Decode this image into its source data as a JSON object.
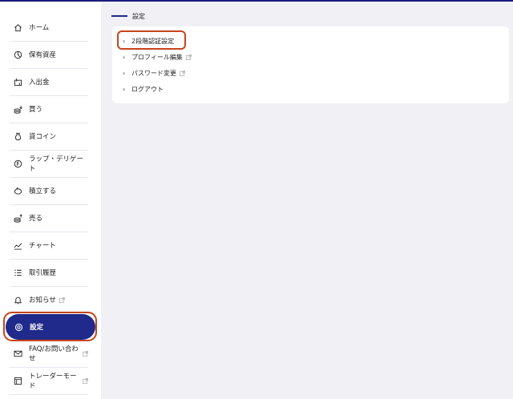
{
  "sidebar": {
    "items": [
      {
        "label": "ホーム",
        "icon": "home-icon"
      },
      {
        "label": "保有資産",
        "icon": "portfolio-icon"
      },
      {
        "label": "入出金",
        "icon": "deposit-withdraw-icon"
      },
      {
        "label": "買う",
        "icon": "buy-icon"
      },
      {
        "label": "貸コイン",
        "icon": "lend-coin-icon"
      },
      {
        "label": "ラップ・デリゲート",
        "icon": "wrap-delegate-icon"
      },
      {
        "label": "積立する",
        "icon": "piggy-bank-icon"
      },
      {
        "label": "売る",
        "icon": "sell-icon"
      },
      {
        "label": "チャート",
        "icon": "chart-icon"
      },
      {
        "label": "取引履歴",
        "icon": "history-icon"
      },
      {
        "label": "お知らせ",
        "icon": "bell-icon"
      },
      {
        "label": "設定",
        "icon": "gear-icon"
      },
      {
        "label": "FAQ/お問い合わせ",
        "icon": "mail-icon"
      },
      {
        "label": "トレーダーモード",
        "icon": "trader-icon"
      }
    ]
  },
  "main": {
    "title": "設定",
    "menu": [
      {
        "label": "2段階認証設定"
      },
      {
        "label": "プロフィール編集"
      },
      {
        "label": "パスワード変更"
      },
      {
        "label": "ログアウト"
      }
    ]
  },
  "colors": {
    "accent": "#1f2a8a",
    "highlight": "#c8441c",
    "background": "#f0f0f5"
  }
}
